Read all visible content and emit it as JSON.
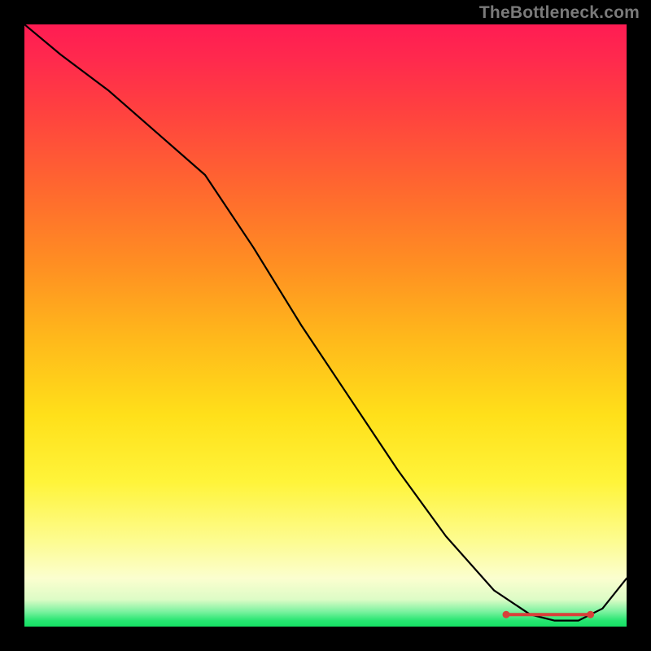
{
  "watermark": "TheBottleneck.com",
  "chart_data": {
    "type": "line",
    "title": "",
    "xlabel": "",
    "ylabel": "",
    "xlim": [
      0,
      100
    ],
    "ylim": [
      0,
      100
    ],
    "grid": false,
    "legend": false,
    "background_gradient": {
      "orientation": "vertical",
      "stops": [
        {
          "pos": 0,
          "color": "#ff1c53"
        },
        {
          "pos": 0.28,
          "color": "#ff6a2e"
        },
        {
          "pos": 0.52,
          "color": "#ffb81b"
        },
        {
          "pos": 0.76,
          "color": "#fff43a"
        },
        {
          "pos": 0.92,
          "color": "#fbfecf"
        },
        {
          "pos": 0.985,
          "color": "#27e671"
        },
        {
          "pos": 1.0,
          "color": "#15e064"
        }
      ]
    },
    "series": [
      {
        "name": "bottleneck-curve",
        "x": [
          0,
          6,
          14,
          22,
          30,
          38,
          46,
          54,
          62,
          70,
          78,
          84,
          88,
          92,
          96,
          100
        ],
        "y": [
          100,
          95,
          89,
          82,
          75,
          63,
          50,
          38,
          26,
          15,
          6,
          2,
          1,
          1,
          3,
          8
        ]
      }
    ],
    "markers": [
      {
        "name": "optimal-range",
        "type": "segment",
        "x_start": 80,
        "x_end": 94,
        "y": 2,
        "color": "#d9403a"
      }
    ]
  }
}
